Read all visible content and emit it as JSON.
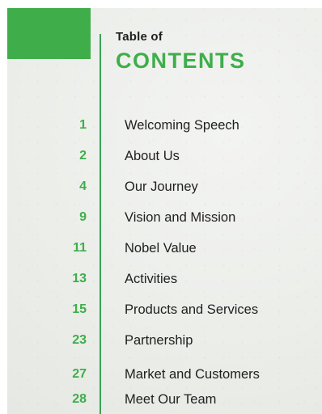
{
  "header": {
    "title_line1": "Table of",
    "title_line2": "CONTENTS"
  },
  "toc": [
    {
      "page": "1",
      "title": "Welcoming Speech"
    },
    {
      "page": "2",
      "title": "About Us"
    },
    {
      "page": "4",
      "title": "Our Journey"
    },
    {
      "page": "9",
      "title": "Vision and Mission"
    },
    {
      "page": "11",
      "title": "Nobel Value"
    },
    {
      "page": "13",
      "title": "Activities"
    },
    {
      "page": "15",
      "title": "Products and Services"
    },
    {
      "page": "23",
      "title": "Partnership"
    },
    {
      "page": "27",
      "title": "Market and Customers"
    },
    {
      "page": "28",
      "title": "Meet Our Team"
    }
  ],
  "colors": {
    "accent": "#3fae4a",
    "text": "#1f1f1f",
    "background": "#eceeea"
  }
}
